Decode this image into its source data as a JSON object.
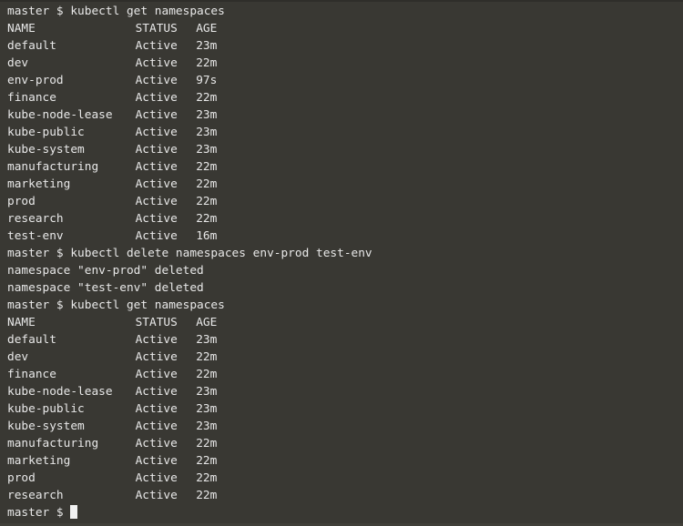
{
  "terminal": {
    "colors": {
      "background": "#393833",
      "foreground": "#e8e8e8",
      "cursor": "#f2f2f2",
      "top_edge": "#2f2e2a",
      "bottom_edge": "#403f39"
    },
    "prompt": "master $ ",
    "cursor_glyph": "block-cursor",
    "columns": {
      "name": "NAME",
      "status": "STATUS",
      "age": "AGE"
    },
    "blocks": [
      {
        "type": "command",
        "prompt": "master $ ",
        "command": "kubectl get namespaces"
      },
      {
        "type": "table",
        "header": {
          "name": "NAME",
          "status": "STATUS",
          "age": "AGE"
        },
        "rows": [
          {
            "name": "default",
            "status": "Active",
            "age": "23m"
          },
          {
            "name": "dev",
            "status": "Active",
            "age": "22m"
          },
          {
            "name": "env-prod",
            "status": "Active",
            "age": "97s"
          },
          {
            "name": "finance",
            "status": "Active",
            "age": "22m"
          },
          {
            "name": "kube-node-lease",
            "status": "Active",
            "age": "23m"
          },
          {
            "name": "kube-public",
            "status": "Active",
            "age": "23m"
          },
          {
            "name": "kube-system",
            "status": "Active",
            "age": "23m"
          },
          {
            "name": "manufacturing",
            "status": "Active",
            "age": "22m"
          },
          {
            "name": "marketing",
            "status": "Active",
            "age": "22m"
          },
          {
            "name": "prod",
            "status": "Active",
            "age": "22m"
          },
          {
            "name": "research",
            "status": "Active",
            "age": "22m"
          },
          {
            "name": "test-env",
            "status": "Active",
            "age": "16m"
          }
        ]
      },
      {
        "type": "command",
        "prompt": "master $ ",
        "command": "kubectl delete namespaces env-prod test-env"
      },
      {
        "type": "output",
        "lines": [
          "namespace \"env-prod\" deleted",
          "namespace \"test-env\" deleted"
        ]
      },
      {
        "type": "command",
        "prompt": "master $ ",
        "command": "kubectl get namespaces"
      },
      {
        "type": "table",
        "header": {
          "name": "NAME",
          "status": "STATUS",
          "age": "AGE"
        },
        "rows": [
          {
            "name": "default",
            "status": "Active",
            "age": "23m"
          },
          {
            "name": "dev",
            "status": "Active",
            "age": "22m"
          },
          {
            "name": "finance",
            "status": "Active",
            "age": "22m"
          },
          {
            "name": "kube-node-lease",
            "status": "Active",
            "age": "23m"
          },
          {
            "name": "kube-public",
            "status": "Active",
            "age": "23m"
          },
          {
            "name": "kube-system",
            "status": "Active",
            "age": "23m"
          },
          {
            "name": "manufacturing",
            "status": "Active",
            "age": "22m"
          },
          {
            "name": "marketing",
            "status": "Active",
            "age": "22m"
          },
          {
            "name": "prod",
            "status": "Active",
            "age": "22m"
          },
          {
            "name": "research",
            "status": "Active",
            "age": "22m"
          }
        ]
      },
      {
        "type": "prompt",
        "prompt": "master $ "
      }
    ]
  }
}
